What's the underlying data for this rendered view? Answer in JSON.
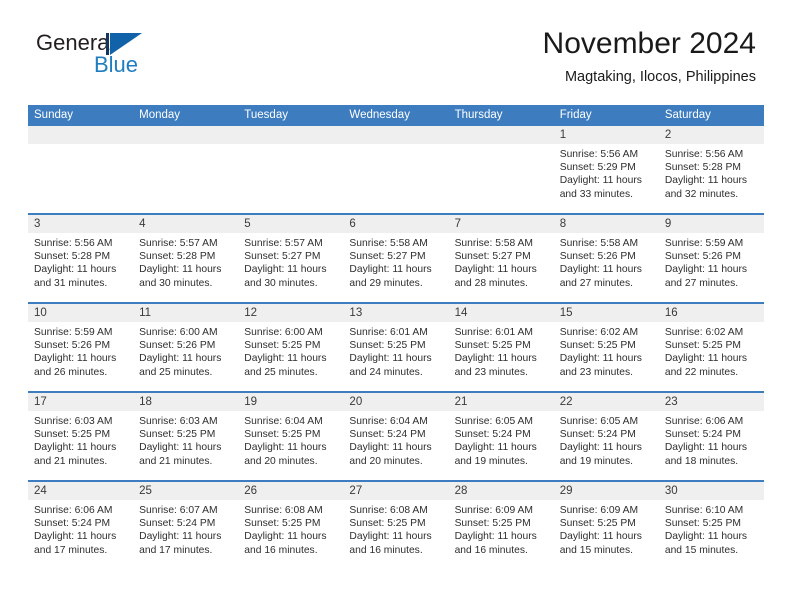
{
  "brand": {
    "name_part1": "General",
    "name_part2": "Blue",
    "accent_color": "#1f7dc0",
    "triangle_color": "#1162a8"
  },
  "header": {
    "title": "November 2024",
    "subtitle": "Magtaking, Ilocos, Philippines"
  },
  "theme": {
    "header_row_color": "#3c7cbf",
    "day_number_bg": "#efefef",
    "cell_bg": "#ffffff"
  },
  "weekdays": [
    "Sunday",
    "Monday",
    "Tuesday",
    "Wednesday",
    "Thursday",
    "Friday",
    "Saturday"
  ],
  "weeks": [
    [
      {
        "date": "",
        "empty": true,
        "sunrise": "",
        "sunset": "",
        "daylight_line1": "",
        "daylight_line2": ""
      },
      {
        "date": "",
        "empty": true,
        "sunrise": "",
        "sunset": "",
        "daylight_line1": "",
        "daylight_line2": ""
      },
      {
        "date": "",
        "empty": true,
        "sunrise": "",
        "sunset": "",
        "daylight_line1": "",
        "daylight_line2": ""
      },
      {
        "date": "",
        "empty": true,
        "sunrise": "",
        "sunset": "",
        "daylight_line1": "",
        "daylight_line2": ""
      },
      {
        "date": "",
        "empty": true,
        "sunrise": "",
        "sunset": "",
        "daylight_line1": "",
        "daylight_line2": ""
      },
      {
        "date": "1",
        "empty": false,
        "sunrise": "Sunrise: 5:56 AM",
        "sunset": "Sunset: 5:29 PM",
        "daylight_line1": "Daylight: 11 hours",
        "daylight_line2": "and 33 minutes."
      },
      {
        "date": "2",
        "empty": false,
        "sunrise": "Sunrise: 5:56 AM",
        "sunset": "Sunset: 5:28 PM",
        "daylight_line1": "Daylight: 11 hours",
        "daylight_line2": "and 32 minutes."
      }
    ],
    [
      {
        "date": "3",
        "empty": false,
        "sunrise": "Sunrise: 5:56 AM",
        "sunset": "Sunset: 5:28 PM",
        "daylight_line1": "Daylight: 11 hours",
        "daylight_line2": "and 31 minutes."
      },
      {
        "date": "4",
        "empty": false,
        "sunrise": "Sunrise: 5:57 AM",
        "sunset": "Sunset: 5:28 PM",
        "daylight_line1": "Daylight: 11 hours",
        "daylight_line2": "and 30 minutes."
      },
      {
        "date": "5",
        "empty": false,
        "sunrise": "Sunrise: 5:57 AM",
        "sunset": "Sunset: 5:27 PM",
        "daylight_line1": "Daylight: 11 hours",
        "daylight_line2": "and 30 minutes."
      },
      {
        "date": "6",
        "empty": false,
        "sunrise": "Sunrise: 5:58 AM",
        "sunset": "Sunset: 5:27 PM",
        "daylight_line1": "Daylight: 11 hours",
        "daylight_line2": "and 29 minutes."
      },
      {
        "date": "7",
        "empty": false,
        "sunrise": "Sunrise: 5:58 AM",
        "sunset": "Sunset: 5:27 PM",
        "daylight_line1": "Daylight: 11 hours",
        "daylight_line2": "and 28 minutes."
      },
      {
        "date": "8",
        "empty": false,
        "sunrise": "Sunrise: 5:58 AM",
        "sunset": "Sunset: 5:26 PM",
        "daylight_line1": "Daylight: 11 hours",
        "daylight_line2": "and 27 minutes."
      },
      {
        "date": "9",
        "empty": false,
        "sunrise": "Sunrise: 5:59 AM",
        "sunset": "Sunset: 5:26 PM",
        "daylight_line1": "Daylight: 11 hours",
        "daylight_line2": "and 27 minutes."
      }
    ],
    [
      {
        "date": "10",
        "empty": false,
        "sunrise": "Sunrise: 5:59 AM",
        "sunset": "Sunset: 5:26 PM",
        "daylight_line1": "Daylight: 11 hours",
        "daylight_line2": "and 26 minutes."
      },
      {
        "date": "11",
        "empty": false,
        "sunrise": "Sunrise: 6:00 AM",
        "sunset": "Sunset: 5:26 PM",
        "daylight_line1": "Daylight: 11 hours",
        "daylight_line2": "and 25 minutes."
      },
      {
        "date": "12",
        "empty": false,
        "sunrise": "Sunrise: 6:00 AM",
        "sunset": "Sunset: 5:25 PM",
        "daylight_line1": "Daylight: 11 hours",
        "daylight_line2": "and 25 minutes."
      },
      {
        "date": "13",
        "empty": false,
        "sunrise": "Sunrise: 6:01 AM",
        "sunset": "Sunset: 5:25 PM",
        "daylight_line1": "Daylight: 11 hours",
        "daylight_line2": "and 24 minutes."
      },
      {
        "date": "14",
        "empty": false,
        "sunrise": "Sunrise: 6:01 AM",
        "sunset": "Sunset: 5:25 PM",
        "daylight_line1": "Daylight: 11 hours",
        "daylight_line2": "and 23 minutes."
      },
      {
        "date": "15",
        "empty": false,
        "sunrise": "Sunrise: 6:02 AM",
        "sunset": "Sunset: 5:25 PM",
        "daylight_line1": "Daylight: 11 hours",
        "daylight_line2": "and 23 minutes."
      },
      {
        "date": "16",
        "empty": false,
        "sunrise": "Sunrise: 6:02 AM",
        "sunset": "Sunset: 5:25 PM",
        "daylight_line1": "Daylight: 11 hours",
        "daylight_line2": "and 22 minutes."
      }
    ],
    [
      {
        "date": "17",
        "empty": false,
        "sunrise": "Sunrise: 6:03 AM",
        "sunset": "Sunset: 5:25 PM",
        "daylight_line1": "Daylight: 11 hours",
        "daylight_line2": "and 21 minutes."
      },
      {
        "date": "18",
        "empty": false,
        "sunrise": "Sunrise: 6:03 AM",
        "sunset": "Sunset: 5:25 PM",
        "daylight_line1": "Daylight: 11 hours",
        "daylight_line2": "and 21 minutes."
      },
      {
        "date": "19",
        "empty": false,
        "sunrise": "Sunrise: 6:04 AM",
        "sunset": "Sunset: 5:25 PM",
        "daylight_line1": "Daylight: 11 hours",
        "daylight_line2": "and 20 minutes."
      },
      {
        "date": "20",
        "empty": false,
        "sunrise": "Sunrise: 6:04 AM",
        "sunset": "Sunset: 5:24 PM",
        "daylight_line1": "Daylight: 11 hours",
        "daylight_line2": "and 20 minutes."
      },
      {
        "date": "21",
        "empty": false,
        "sunrise": "Sunrise: 6:05 AM",
        "sunset": "Sunset: 5:24 PM",
        "daylight_line1": "Daylight: 11 hours",
        "daylight_line2": "and 19 minutes."
      },
      {
        "date": "22",
        "empty": false,
        "sunrise": "Sunrise: 6:05 AM",
        "sunset": "Sunset: 5:24 PM",
        "daylight_line1": "Daylight: 11 hours",
        "daylight_line2": "and 19 minutes."
      },
      {
        "date": "23",
        "empty": false,
        "sunrise": "Sunrise: 6:06 AM",
        "sunset": "Sunset: 5:24 PM",
        "daylight_line1": "Daylight: 11 hours",
        "daylight_line2": "and 18 minutes."
      }
    ],
    [
      {
        "date": "24",
        "empty": false,
        "sunrise": "Sunrise: 6:06 AM",
        "sunset": "Sunset: 5:24 PM",
        "daylight_line1": "Daylight: 11 hours",
        "daylight_line2": "and 17 minutes."
      },
      {
        "date": "25",
        "empty": false,
        "sunrise": "Sunrise: 6:07 AM",
        "sunset": "Sunset: 5:24 PM",
        "daylight_line1": "Daylight: 11 hours",
        "daylight_line2": "and 17 minutes."
      },
      {
        "date": "26",
        "empty": false,
        "sunrise": "Sunrise: 6:08 AM",
        "sunset": "Sunset: 5:25 PM",
        "daylight_line1": "Daylight: 11 hours",
        "daylight_line2": "and 16 minutes."
      },
      {
        "date": "27",
        "empty": false,
        "sunrise": "Sunrise: 6:08 AM",
        "sunset": "Sunset: 5:25 PM",
        "daylight_line1": "Daylight: 11 hours",
        "daylight_line2": "and 16 minutes."
      },
      {
        "date": "28",
        "empty": false,
        "sunrise": "Sunrise: 6:09 AM",
        "sunset": "Sunset: 5:25 PM",
        "daylight_line1": "Daylight: 11 hours",
        "daylight_line2": "and 16 minutes."
      },
      {
        "date": "29",
        "empty": false,
        "sunrise": "Sunrise: 6:09 AM",
        "sunset": "Sunset: 5:25 PM",
        "daylight_line1": "Daylight: 11 hours",
        "daylight_line2": "and 15 minutes."
      },
      {
        "date": "30",
        "empty": false,
        "sunrise": "Sunrise: 6:10 AM",
        "sunset": "Sunset: 5:25 PM",
        "daylight_line1": "Daylight: 11 hours",
        "daylight_line2": "and 15 minutes."
      }
    ]
  ]
}
